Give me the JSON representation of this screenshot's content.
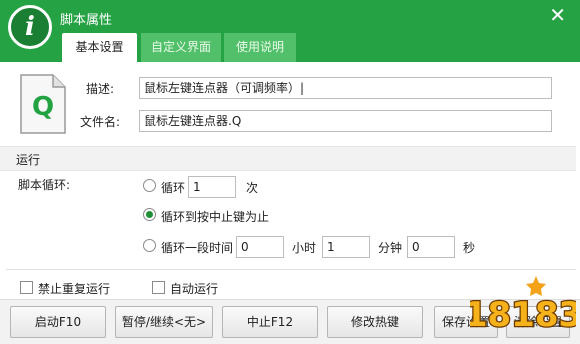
{
  "window": {
    "title": "脚本属性",
    "logo_glyph": "i",
    "close_glyph": "✕"
  },
  "tabs": [
    {
      "label": "基本设置",
      "active": true
    },
    {
      "label": "自定义界面",
      "active": false
    },
    {
      "label": "使用说明",
      "active": false
    }
  ],
  "file_icon": {
    "glyph": "Q"
  },
  "form": {
    "desc_label": "描述:",
    "desc_value": "鼠标左键连点器（可调频率）|",
    "filename_label": "文件名:",
    "filename_value": "鼠标左键连点器.Q"
  },
  "run": {
    "section_title": "运行",
    "loop_label": "脚本循环:",
    "option1_label": "循环",
    "option1_value": "1",
    "option1_unit": "次",
    "option2_label": "循环到按中止键为止",
    "option3_label": "循环一段时间",
    "hours_value": "0",
    "hours_unit": "小时",
    "minutes_value": "1",
    "minutes_unit": "分钟",
    "seconds_value": "0",
    "seconds_unit": "秒",
    "selected_option": 2
  },
  "checkboxes": [
    {
      "label": "禁止重复运行",
      "checked": false
    },
    {
      "label": "自动运行",
      "checked": false
    }
  ],
  "buttons": {
    "start": "启动F10",
    "pause": "暂停/继续<无>",
    "stop": "中止F12",
    "hotkey": "修改热键",
    "save": "保存设置",
    "clear": "清除设置"
  },
  "watermark": {
    "text": "18183"
  },
  "colors": {
    "brand_green": "#25a244",
    "tab_inactive": "#52c06a",
    "watermark_orange": "#f39800"
  }
}
